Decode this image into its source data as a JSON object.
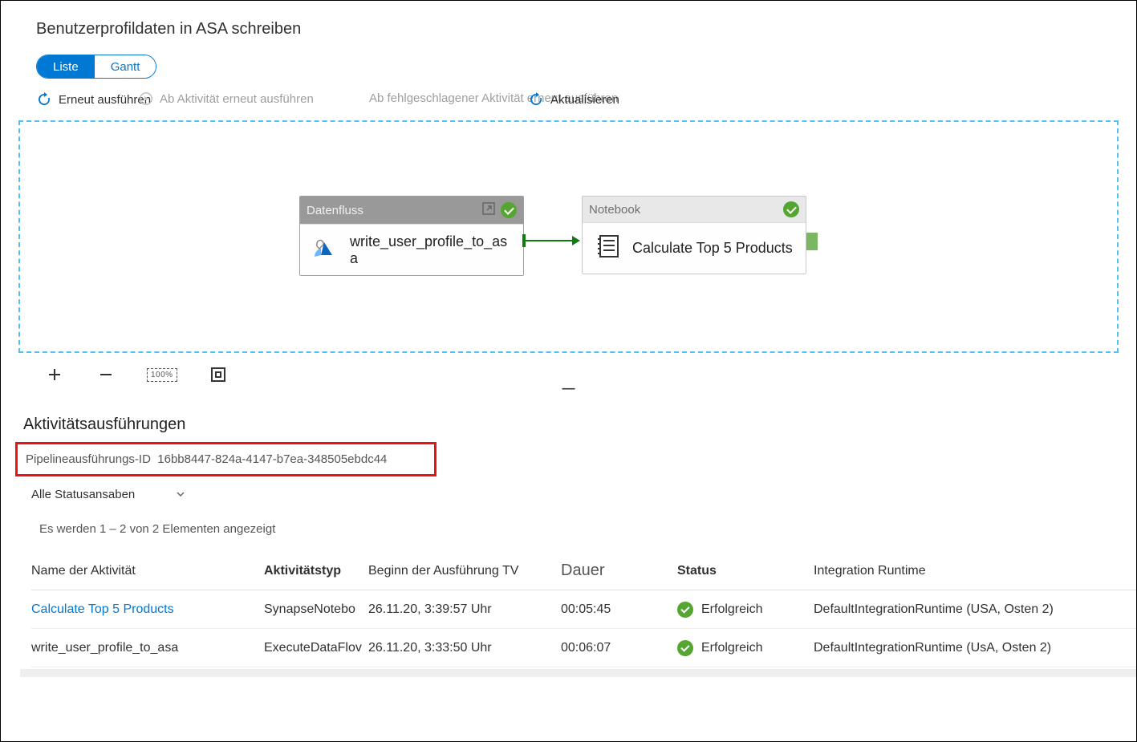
{
  "header": {
    "title": "Benutzerprofildaten in ASA schreiben"
  },
  "toggle": {
    "list": "Liste",
    "gantt": "Gantt"
  },
  "toolbar": {
    "rerun": "Erneut ausführen",
    "rerun_from": "Ab Aktivität erneut ausführen",
    "rerun_failed": "Ab fehlgeschlagener Aktivität erneut ausführen",
    "refresh": "Aktualisieren"
  },
  "canvas": {
    "node1": {
      "type": "Datenfluss",
      "name": "write_user_profile_to_asa"
    },
    "node2": {
      "type": "Notebook",
      "name": "Calculate Top 5 Products"
    }
  },
  "zoom": {
    "value": "100%"
  },
  "runs": {
    "section": "Aktivitätsausführungen",
    "run_id_label": "Pipelineausführungs-ID",
    "run_id": "16bb8447-824a-4147-b7ea-348505ebdc44",
    "filter_label": "Alle Statusansaben",
    "showing": "Es werden 1 –  2 von 2 Elementen angezeigt",
    "headers": {
      "name": "Name der Aktivität",
      "type": "Aktivitätstyp",
      "start": "Beginn der Ausführung TV",
      "duration": "Dauer",
      "status": "Status",
      "ir": "Integration Runtime"
    },
    "rows": [
      {
        "name": "Calculate Top 5 Products",
        "type": "SynapseNotebo",
        "start": "26.11.20, 3:39:57  Uhr",
        "duration": "00:05:45",
        "status": "Erfolgreich",
        "ir": "DefaultIntegrationRuntime (USA, Osten 2)",
        "link": true
      },
      {
        "name": "write_user_profile_to_asa",
        "type": "ExecuteDataFlov",
        "start": "26.11.20, 3:33:50  Uhr",
        "duration": "00:06:07",
        "status": "Erfolgreich",
        "ir": "DefaultIntegrationRuntime (UsA, Osten 2)",
        "link": false
      }
    ]
  }
}
